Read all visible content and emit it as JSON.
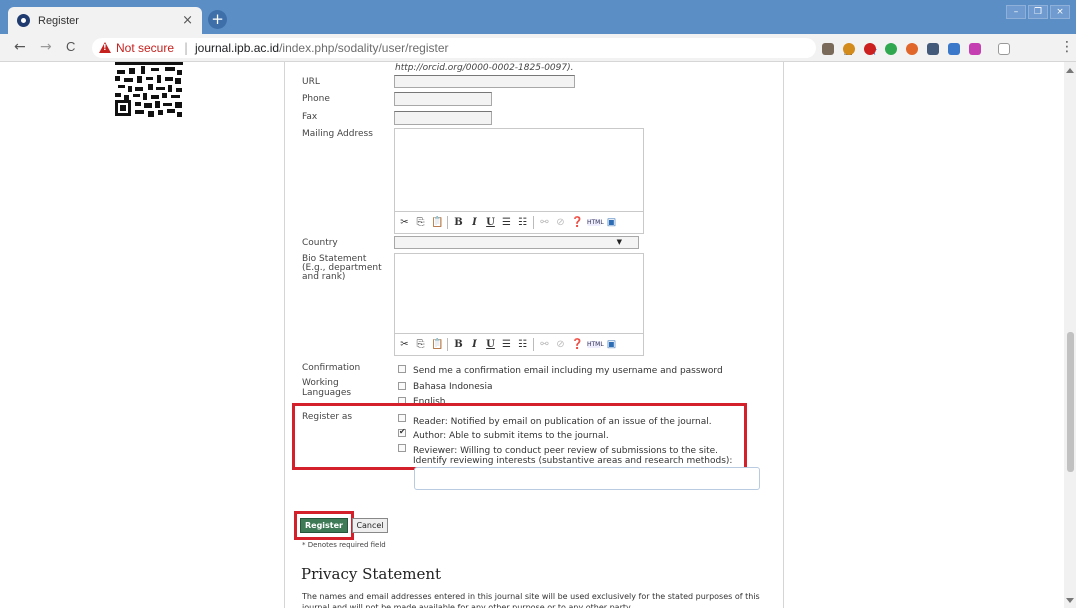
{
  "browser": {
    "tab_title": "Register",
    "tab_close": "×",
    "new_tab": "+",
    "window_controls": [
      "–",
      "❐",
      "×"
    ],
    "nav": {
      "back": "←",
      "forward": "→",
      "reload": "C"
    },
    "security_label": "Not secure",
    "url_host": "journal.ipb.ac.id",
    "url_path": "/index.php/sodality/user/register",
    "key_icon": "key-icon",
    "bookmark_icon": "star-icon",
    "menu": "⋮",
    "extension_colors": [
      "#7a6a5a",
      "#d38b1c",
      "#cc1f1f",
      "#2fa84f",
      "#e0662a",
      "#445a7a",
      "#3b78c9",
      "#c63fb2"
    ]
  },
  "form": {
    "orcid_hint": "http://orcid.org/0000-0002-1825-0097).",
    "url_label": "URL",
    "phone_label": "Phone",
    "fax_label": "Fax",
    "mailing_label": "Mailing Address",
    "country_label": "Country",
    "bio_label_1": "Bio Statement",
    "bio_label_2": "(E.g., department",
    "bio_label_3": "and rank)",
    "confirmation_label": "Confirmation",
    "confirmation_text": "Send me a confirmation email including my username and password",
    "working_lang_label_1": "Working",
    "working_lang_label_2": "Languages",
    "lang_1": "Bahasa Indonesia",
    "lang_2": "English",
    "register_as_label": "Register as",
    "role_reader": "Reader: Notified by email on publication of an issue of the journal.",
    "role_author": "Author: Able to submit items to the journal.",
    "role_reviewer_1": "Reviewer: Willing to conduct peer review of submissions to the site.",
    "role_reviewer_2": "Identify reviewing interests (substantive areas and research methods):",
    "role_reader_checked": false,
    "role_author_checked": true,
    "role_reviewer_checked": false,
    "register_button": "Register",
    "cancel_button": "Cancel",
    "required_note": "* Denotes required field"
  },
  "privacy": {
    "title": "Privacy Statement",
    "body": "The names and email addresses entered in this journal site will be used exclusively for the stated purposes of this journal and will not be made available for any other purpose or to any other party."
  },
  "highlight_color": "#d3202a"
}
